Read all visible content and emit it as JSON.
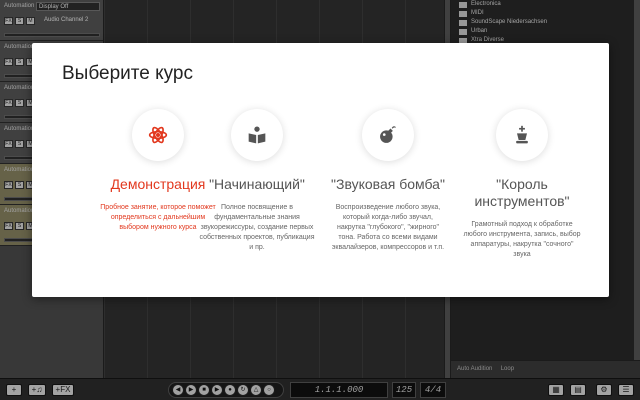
{
  "tracks": [
    {
      "automation": "Automation",
      "mode": "Display Off",
      "name": "Audio Channel 2",
      "color": "#555555"
    },
    {
      "automation": "Automation",
      "mode": "",
      "name": "",
      "color": "#555555"
    },
    {
      "automation": "Automation",
      "mode": "",
      "name": "",
      "color": "#555555"
    },
    {
      "automation": "Automation",
      "mode": "",
      "name": "",
      "color": "#555555"
    },
    {
      "automation": "Automation",
      "mode": "",
      "name": "",
      "color": "#8a8460"
    },
    {
      "automation": "Automation",
      "mode": "",
      "name": "",
      "color": "#8a8460"
    }
  ],
  "track_buttons": {
    "fx": "FX",
    "solo": "S",
    "mute": "M"
  },
  "browser": {
    "items": [
      "Electronica",
      "MIDI",
      "SoundScape Niedersachsen",
      "Urban",
      "Xtra Diverse"
    ],
    "footer_left": "Auto Audition",
    "footer_mid": "Loop"
  },
  "transport": {
    "add": "+",
    "add_instrument": "+♫",
    "add_fx": "+FX",
    "position": "1.1.1.000",
    "tempo": "125",
    "signature": "4/4"
  },
  "modal": {
    "title": "Выберите курс",
    "courses": [
      {
        "icon": "atom-icon",
        "title": "Демонстрация",
        "description": "Пробное занятие, которое поможет определиться с дальнейшим выбором нужного курса",
        "active": true
      },
      {
        "icon": "book-reader-icon",
        "title": "\"Начинающий\"",
        "description": "Полное посвящение в фундаментальные знания звукорежиссуры, создание первых собственных проектов, публикация и пр.",
        "active": false
      },
      {
        "icon": "bomb-icon",
        "title": "\"Звуковая бомба\"",
        "description": "Воспроизведение любого звука, который когда-либо звучал, накрутка \"глубокого\", \"жирного\" тона. Работа со всеми видами эквалайзеров, компрессоров и т.п.",
        "active": false
      },
      {
        "icon": "chess-king-icon",
        "title": "\"Король инструментов\"",
        "description": "Грамотный подход к обработке любого инструмента, запись, выбор аппаратуры, накрутка \"сочного\" звука",
        "active": false
      }
    ]
  },
  "colors": {
    "accent": "#e2381e",
    "text": "#555555"
  }
}
